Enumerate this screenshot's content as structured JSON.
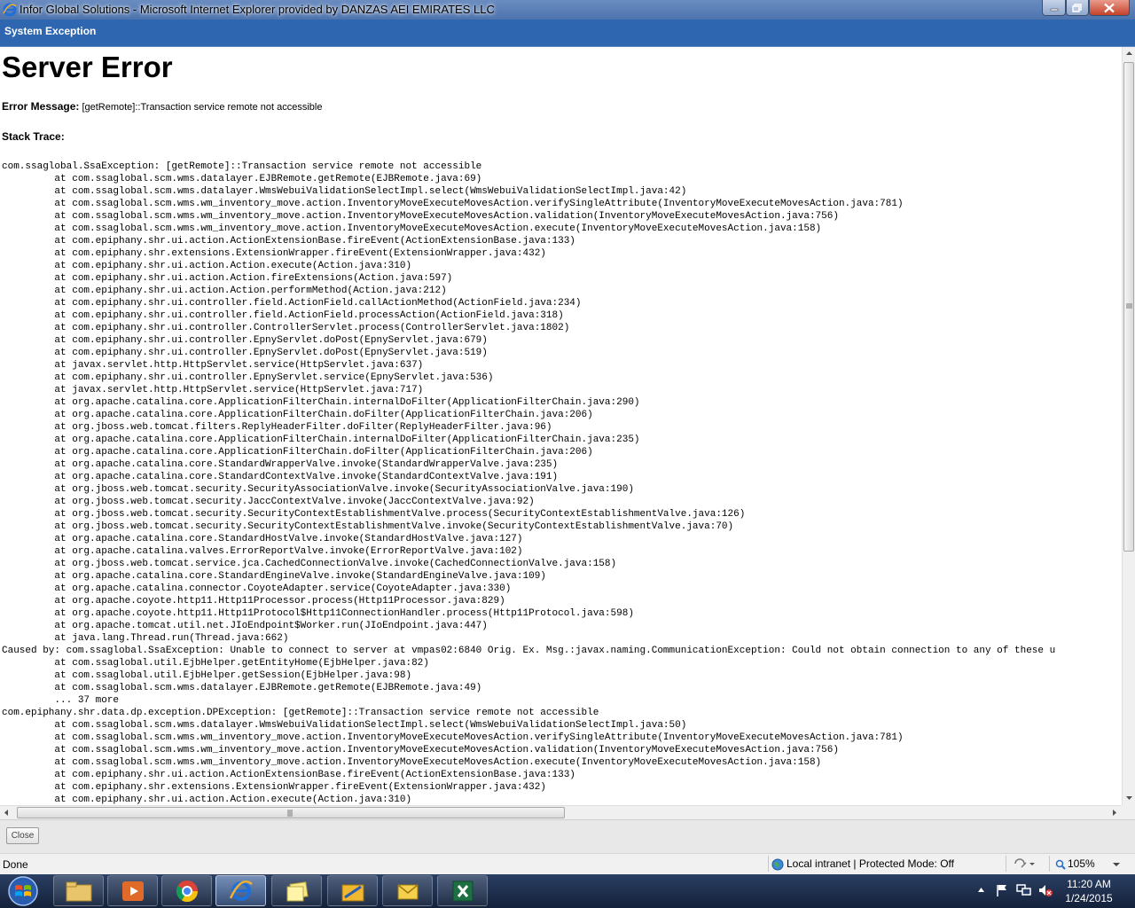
{
  "window": {
    "title": "Infor Global Solutions - Microsoft Internet Explorer provided by DANZAS AEI EMIRATES LLC"
  },
  "header": {
    "title": "System Exception"
  },
  "page": {
    "heading": "Server Error",
    "error_label": "Error Message:",
    "error_text": "[getRemote]::Transaction service remote not accessible",
    "stack_label": "Stack Trace:",
    "stack_trace": [
      "com.ssaglobal.SsaException: [getRemote]::Transaction service remote not accessible",
      "         at com.ssaglobal.scm.wms.datalayer.EJBRemote.getRemote(EJBRemote.java:69)",
      "         at com.ssaglobal.scm.wms.datalayer.WmsWebuiValidationSelectImpl.select(WmsWebuiValidationSelectImpl.java:42)",
      "         at com.ssaglobal.scm.wms.wm_inventory_move.action.InventoryMoveExecuteMovesAction.verifySingleAttribute(InventoryMoveExecuteMovesAction.java:781)",
      "         at com.ssaglobal.scm.wms.wm_inventory_move.action.InventoryMoveExecuteMovesAction.validation(InventoryMoveExecuteMovesAction.java:756)",
      "         at com.ssaglobal.scm.wms.wm_inventory_move.action.InventoryMoveExecuteMovesAction.execute(InventoryMoveExecuteMovesAction.java:158)",
      "         at com.epiphany.shr.ui.action.ActionExtensionBase.fireEvent(ActionExtensionBase.java:133)",
      "         at com.epiphany.shr.extensions.ExtensionWrapper.fireEvent(ExtensionWrapper.java:432)",
      "         at com.epiphany.shr.ui.action.Action.execute(Action.java:310)",
      "         at com.epiphany.shr.ui.action.Action.fireExtensions(Action.java:597)",
      "         at com.epiphany.shr.ui.action.Action.performMethod(Action.java:212)",
      "         at com.epiphany.shr.ui.controller.field.ActionField.callActionMethod(ActionField.java:234)",
      "         at com.epiphany.shr.ui.controller.field.ActionField.processAction(ActionField.java:318)",
      "         at com.epiphany.shr.ui.controller.ControllerServlet.process(ControllerServlet.java:1802)",
      "         at com.epiphany.shr.ui.controller.EpnyServlet.doPost(EpnyServlet.java:679)",
      "         at com.epiphany.shr.ui.controller.EpnyServlet.doPost(EpnyServlet.java:519)",
      "         at javax.servlet.http.HttpServlet.service(HttpServlet.java:637)",
      "         at com.epiphany.shr.ui.controller.EpnyServlet.service(EpnyServlet.java:536)",
      "         at javax.servlet.http.HttpServlet.service(HttpServlet.java:717)",
      "         at org.apache.catalina.core.ApplicationFilterChain.internalDoFilter(ApplicationFilterChain.java:290)",
      "         at org.apache.catalina.core.ApplicationFilterChain.doFilter(ApplicationFilterChain.java:206)",
      "         at org.jboss.web.tomcat.filters.ReplyHeaderFilter.doFilter(ReplyHeaderFilter.java:96)",
      "         at org.apache.catalina.core.ApplicationFilterChain.internalDoFilter(ApplicationFilterChain.java:235)",
      "         at org.apache.catalina.core.ApplicationFilterChain.doFilter(ApplicationFilterChain.java:206)",
      "         at org.apache.catalina.core.StandardWrapperValve.invoke(StandardWrapperValve.java:235)",
      "         at org.apache.catalina.core.StandardContextValve.invoke(StandardContextValve.java:191)",
      "         at org.jboss.web.tomcat.security.SecurityAssociationValve.invoke(SecurityAssociationValve.java:190)",
      "         at org.jboss.web.tomcat.security.JaccContextValve.invoke(JaccContextValve.java:92)",
      "         at org.jboss.web.tomcat.security.SecurityContextEstablishmentValve.process(SecurityContextEstablishmentValve.java:126)",
      "         at org.jboss.web.tomcat.security.SecurityContextEstablishmentValve.invoke(SecurityContextEstablishmentValve.java:70)",
      "         at org.apache.catalina.core.StandardHostValve.invoke(StandardHostValve.java:127)",
      "         at org.apache.catalina.valves.ErrorReportValve.invoke(ErrorReportValve.java:102)",
      "         at org.jboss.web.tomcat.service.jca.CachedConnectionValve.invoke(CachedConnectionValve.java:158)",
      "         at org.apache.catalina.core.StandardEngineValve.invoke(StandardEngineValve.java:109)",
      "         at org.apache.catalina.connector.CoyoteAdapter.service(CoyoteAdapter.java:330)",
      "         at org.apache.coyote.http11.Http11Processor.process(Http11Processor.java:829)",
      "         at org.apache.coyote.http11.Http11Protocol$Http11ConnectionHandler.process(Http11Protocol.java:598)",
      "         at org.apache.tomcat.util.net.JIoEndpoint$Worker.run(JIoEndpoint.java:447)",
      "         at java.lang.Thread.run(Thread.java:662)",
      "Caused by: com.ssaglobal.SsaException: Unable to connect to server at vmpas02:6840 Orig. Ex. Msg.:javax.naming.CommunicationException: Could not obtain connection to any of these u",
      "         at com.ssaglobal.util.EjbHelper.getEntityHome(EjbHelper.java:82)",
      "         at com.ssaglobal.util.EjbHelper.getSession(EjbHelper.java:98)",
      "         at com.ssaglobal.scm.wms.datalayer.EJBRemote.getRemote(EJBRemote.java:49)",
      "         ... 37 more",
      "com.epiphany.shr.data.dp.exception.DPException: [getRemote]::Transaction service remote not accessible",
      "         at com.ssaglobal.scm.wms.datalayer.WmsWebuiValidationSelectImpl.select(WmsWebuiValidationSelectImpl.java:50)",
      "         at com.ssaglobal.scm.wms.wm_inventory_move.action.InventoryMoveExecuteMovesAction.verifySingleAttribute(InventoryMoveExecuteMovesAction.java:781)",
      "         at com.ssaglobal.scm.wms.wm_inventory_move.action.InventoryMoveExecuteMovesAction.validation(InventoryMoveExecuteMovesAction.java:756)",
      "         at com.ssaglobal.scm.wms.wm_inventory_move.action.InventoryMoveExecuteMovesAction.execute(InventoryMoveExecuteMovesAction.java:158)",
      "         at com.epiphany.shr.ui.action.ActionExtensionBase.fireEvent(ActionExtensionBase.java:133)",
      "         at com.epiphany.shr.extensions.ExtensionWrapper.fireEvent(ExtensionWrapper.java:432)",
      "         at com.epiphany.shr.ui.action.Action.execute(Action.java:310)"
    ]
  },
  "buttons": {
    "close": "Close"
  },
  "status": {
    "text": "Done",
    "zone": "Local intranet | Protected Mode: Off",
    "zoom": "105%",
    "globe_icon": "globe-icon",
    "security_icon": "security-icon"
  },
  "taskbar": {
    "items": [
      "explorer",
      "media-player",
      "chrome",
      "internet-explorer",
      "sticky-notes",
      "file-manager",
      "outlook",
      "excel"
    ]
  },
  "clock": {
    "time": "11:20 AM",
    "date": "1/24/2015"
  }
}
